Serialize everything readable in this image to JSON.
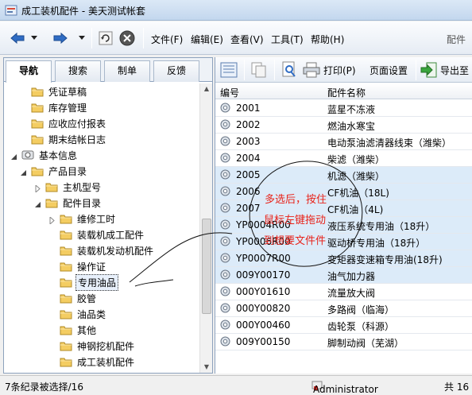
{
  "window": {
    "title": "成工装机配件 - 美天测试帐套"
  },
  "toolbar": {
    "menus": [
      "文件(F)",
      "编辑(E)",
      "查看(V)",
      "工具(T)",
      "帮助(H)"
    ],
    "right_label": "配件"
  },
  "left": {
    "tabs": [
      "导航",
      "搜索",
      "制单",
      "反馈"
    ],
    "tree": [
      {
        "label": "凭证草稿",
        "level": 1,
        "expander": ""
      },
      {
        "label": "库存管理",
        "level": 1,
        "expander": ""
      },
      {
        "label": "应收应付报表",
        "level": 1,
        "expander": ""
      },
      {
        "label": "期末结帐日志",
        "level": 1,
        "expander": ""
      },
      {
        "label": "基本信息",
        "level": 0,
        "expander": "open",
        "icon": "base"
      },
      {
        "label": "产品目录",
        "level": 1,
        "expander": "open"
      },
      {
        "label": "主机型号",
        "level": 2,
        "expander": "closed"
      },
      {
        "label": "配件目录",
        "level": 2,
        "expander": "open"
      },
      {
        "label": "维修工时",
        "level": 3,
        "expander": "closed"
      },
      {
        "label": "装载机成工配件",
        "level": 3,
        "expander": ""
      },
      {
        "label": "装载机发动机配件",
        "level": 3,
        "expander": ""
      },
      {
        "label": "操作证",
        "level": 3,
        "expander": ""
      },
      {
        "label": "专用油品",
        "level": 3,
        "expander": "",
        "selected": true
      },
      {
        "label": "胶管",
        "level": 3,
        "expander": ""
      },
      {
        "label": "油品类",
        "level": 3,
        "expander": ""
      },
      {
        "label": "其他",
        "level": 3,
        "expander": ""
      },
      {
        "label": "神钢挖机配件",
        "level": 3,
        "expander": ""
      },
      {
        "label": "成工装机配件",
        "level": 3,
        "expander": ""
      }
    ]
  },
  "right": {
    "toolbar": {
      "print": "打印(P)",
      "page_setup": "页面设置",
      "export": "导出至"
    },
    "columns": [
      "编号",
      "配件名称"
    ],
    "rows": [
      {
        "code": "2001",
        "name": "蓝星不冻液",
        "selected": false
      },
      {
        "code": "2002",
        "name": "燃油水寒宝",
        "selected": false
      },
      {
        "code": "2003",
        "name": "电动泵油滤清器线束（潍柴）",
        "selected": false
      },
      {
        "code": "2004",
        "name": "柴滤（潍柴）",
        "selected": false
      },
      {
        "code": "2005",
        "name": "机滤（潍柴）",
        "selected": true
      },
      {
        "code": "2006",
        "name": "CF机油（18L)",
        "selected": true
      },
      {
        "code": "2007",
        "name": "CF机油（4L)",
        "selected": true
      },
      {
        "code": "YP0004R00",
        "name": "液压系统专用油（18升）",
        "selected": true
      },
      {
        "code": "YP0006R00",
        "name": "驱动桥专用油（18升）",
        "selected": true
      },
      {
        "code": "YP0007R00",
        "name": "变矩器变速箱专用油(18升)",
        "selected": true
      },
      {
        "code": "009Y00170",
        "name": "油气加力器",
        "selected": true
      },
      {
        "code": "000Y01610",
        "name": "流量放大阀",
        "selected": false
      },
      {
        "code": "000Y00820",
        "name": "多路阀（临海）",
        "selected": false
      },
      {
        "code": "000Y00460",
        "name": "齿轮泵（科源）",
        "selected": false
      },
      {
        "code": "009Y00150",
        "name": "脚制动阀（芜湖）",
        "selected": false
      }
    ]
  },
  "annotation": [
    "多选后，按住",
    "鼠标左键拖动",
    "到想要文件件"
  ],
  "status": {
    "left": "7条纪录被选择/16",
    "user": "Administrator",
    "right": "共 16"
  }
}
